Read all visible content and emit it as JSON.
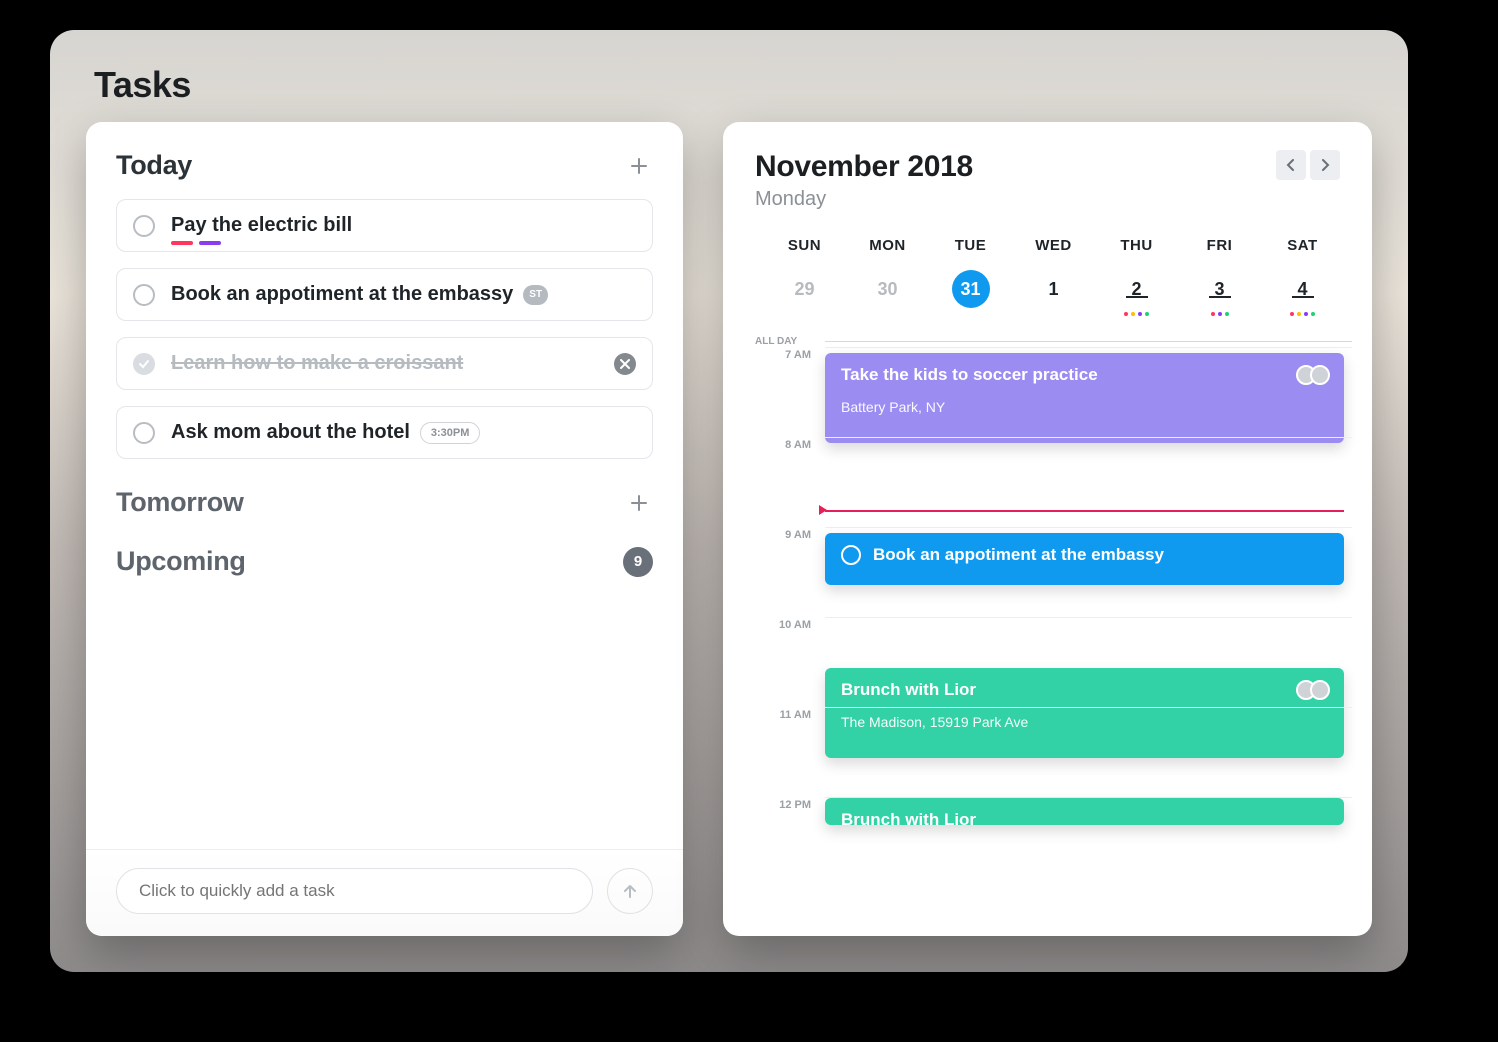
{
  "page_title": "Tasks",
  "tasks": {
    "quick_add_placeholder": "Click to quickly add a task",
    "sections": {
      "today": {
        "title": "Today"
      },
      "tomorrow": {
        "title": "Tomorrow"
      },
      "upcoming": {
        "title": "Upcoming",
        "count": "9"
      }
    },
    "today_items": [
      {
        "title": "Pay the electric bill",
        "done": false,
        "tags": [
          "#ff375f",
          "#8b3cf0"
        ]
      },
      {
        "title": "Book an appotiment at the embassy",
        "done": false,
        "chip": "ST"
      },
      {
        "title": "Learn how to make a croissant",
        "done": true
      },
      {
        "title": "Ask mom about the hotel",
        "done": false,
        "time": "3:30PM"
      }
    ]
  },
  "calendar": {
    "title": "November 2018",
    "subtitle": "Monday",
    "all_day_label": "ALL DAY",
    "weekdays": [
      "SUN",
      "MON",
      "TUE",
      "WED",
      "THU",
      "FRI",
      "SAT"
    ],
    "dates": [
      {
        "label": "29",
        "muted": true
      },
      {
        "label": "30",
        "muted": true
      },
      {
        "label": "31",
        "active": true
      },
      {
        "label": "1"
      },
      {
        "label": "2",
        "underline": true,
        "dots": [
          "#ff375f",
          "#ffbf00",
          "#8b3cf0",
          "#1fd173"
        ]
      },
      {
        "label": "3",
        "underline": true,
        "dots": [
          "#ff375f",
          "#8b3cf0",
          "#1fd173"
        ]
      },
      {
        "label": "4",
        "underline": true,
        "dots": [
          "#ff375f",
          "#ffbf00",
          "#8b3cf0",
          "#1fd173"
        ]
      }
    ],
    "hours": [
      "7 AM",
      "8 AM",
      "9 AM",
      "10 AM",
      "11 AM",
      "12 PM"
    ],
    "now_hour_index": 1,
    "now_frac": 0.8,
    "events": [
      {
        "title": "Take the kids to soccer practice",
        "subtitle": "Battery Park, NY",
        "color": "#9b8cf2",
        "start_index": 0,
        "start_frac": 0.05,
        "height_frac": 1.0,
        "avatars": 2
      },
      {
        "title": "Book an appotiment at the embassy",
        "color": "#0f9af0",
        "start_index": 2,
        "start_frac": 0.05,
        "height_frac": 0.58,
        "check": true
      },
      {
        "title": "Brunch with Lior",
        "subtitle": "The Madison, 15919 Park Ave",
        "color": "#33d1a6",
        "start_index": 3,
        "start_frac": 0.55,
        "height_frac": 1.0,
        "avatars": 2
      },
      {
        "title": "Brunch with Lior",
        "color": "#33d1a6",
        "start_index": 5,
        "start_frac": 0.0,
        "height_frac": 0.3
      }
    ]
  }
}
